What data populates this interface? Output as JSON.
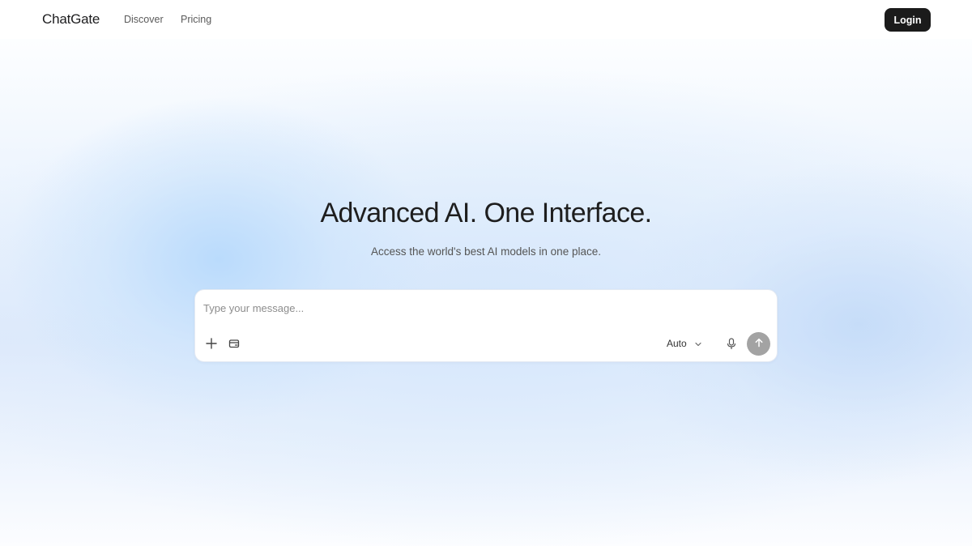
{
  "header": {
    "brand": "ChatGate",
    "nav": [
      {
        "label": "Discover"
      },
      {
        "label": "Pricing"
      }
    ],
    "login_label": "Login"
  },
  "hero": {
    "title": "Advanced AI. One Interface.",
    "subtitle": "Access the world's best AI models in one place."
  },
  "composer": {
    "placeholder": "Type your message...",
    "value": "",
    "model_select": {
      "selected": "Auto"
    },
    "icons": [
      "plus-icon",
      "attach-icon",
      "chevron-down-icon",
      "microphone-icon",
      "arrow-up-icon"
    ],
    "send_button_color": "#a3a3a3"
  },
  "colors": {
    "login_button_bg": "#1b1b1b",
    "background_accent": "#cfe3fb"
  }
}
